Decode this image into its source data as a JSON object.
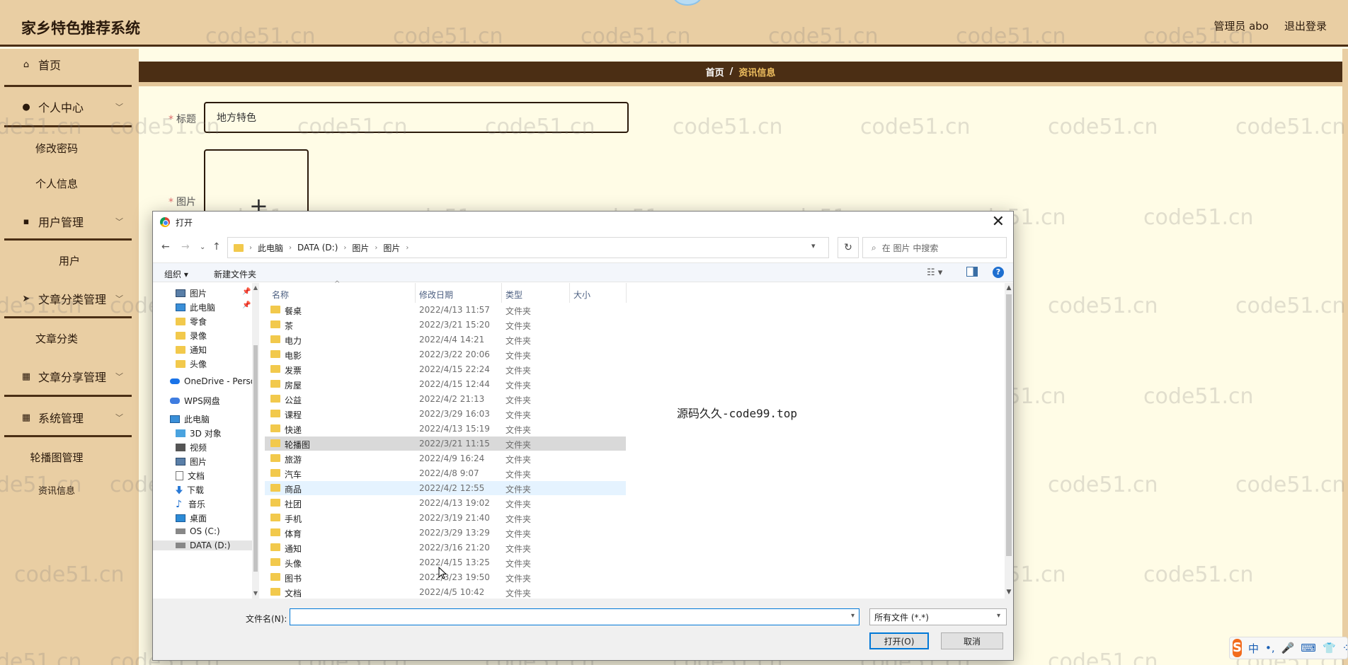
{
  "app": {
    "title": "家乡特色推荐系统",
    "user_label": "管理员 abo",
    "logout_label": "退出登录"
  },
  "sidebar": {
    "items": [
      {
        "label": "首页",
        "icon": "home-icon"
      },
      {
        "label": "个人中心",
        "icon": "user-icon"
      },
      {
        "label": "修改密码"
      },
      {
        "label": "个人信息"
      },
      {
        "label": "用户管理",
        "icon": "users-manage-icon"
      },
      {
        "label": "用户"
      },
      {
        "label": "文章分类管理",
        "icon": "send-icon"
      },
      {
        "label": "文章分类"
      },
      {
        "label": "文章分享管理",
        "icon": "grid-icon"
      },
      {
        "label": "系统管理",
        "icon": "grid-icon"
      },
      {
        "label": "轮播图管理"
      },
      {
        "label": "资讯信息"
      }
    ]
  },
  "breadcrumb": {
    "home": "首页",
    "separator": "/",
    "current": "资讯信息"
  },
  "form": {
    "title_label": "标题",
    "title_value": "地方特色",
    "image_label": "图片",
    "required_mark": "*",
    "upload_plus": "+"
  },
  "watermark": "code51.cn",
  "dialog": {
    "title": "打开",
    "close": "✕",
    "address": {
      "segments": [
        "此电脑",
        "DATA (D:)",
        "图片",
        "图片"
      ]
    },
    "search_placeholder": "在 图片 中搜索",
    "toolbar": {
      "organize": "组织 ▾",
      "new_folder": "新建文件夹"
    },
    "nav_pane": [
      {
        "label": "图片",
        "icon": "pictures-icon",
        "pinned": true
      },
      {
        "label": "此电脑",
        "icon": "pc-icon",
        "pinned": true
      },
      {
        "label": "零食",
        "icon": "folder-icon"
      },
      {
        "label": "录像",
        "icon": "folder-icon"
      },
      {
        "label": "通知",
        "icon": "folder-icon"
      },
      {
        "label": "头像",
        "icon": "folder-icon"
      },
      {
        "label": "OneDrive - Perso",
        "icon": "onedrive-icon"
      },
      {
        "label": "WPS网盘",
        "icon": "wps-cloud-icon"
      },
      {
        "label": "此电脑",
        "icon": "pc-icon"
      },
      {
        "label": "3D 对象",
        "icon": "3d-objects-icon"
      },
      {
        "label": "视频",
        "icon": "video-icon"
      },
      {
        "label": "图片",
        "icon": "pictures-icon"
      },
      {
        "label": "文档",
        "icon": "documents-icon"
      },
      {
        "label": "下载",
        "icon": "download-icon"
      },
      {
        "label": "音乐",
        "icon": "music-icon"
      },
      {
        "label": "桌面",
        "icon": "desktop-icon"
      },
      {
        "label": "OS (C:)",
        "icon": "drive-icon"
      },
      {
        "label": "DATA (D:)",
        "icon": "drive-icon"
      }
    ],
    "columns": [
      "名称",
      "修改日期",
      "类型",
      "大小"
    ],
    "files": [
      {
        "name": "餐桌",
        "date": "2022/4/13 11:57",
        "type": "文件夹"
      },
      {
        "name": "茶",
        "date": "2022/3/21 15:20",
        "type": "文件夹"
      },
      {
        "name": "电力",
        "date": "2022/4/4 14:21",
        "type": "文件夹"
      },
      {
        "name": "电影",
        "date": "2022/3/22 20:06",
        "type": "文件夹"
      },
      {
        "name": "发票",
        "date": "2022/4/15 22:24",
        "type": "文件夹"
      },
      {
        "name": "房屋",
        "date": "2022/4/15 12:44",
        "type": "文件夹"
      },
      {
        "name": "公益",
        "date": "2022/4/2 21:13",
        "type": "文件夹"
      },
      {
        "name": "课程",
        "date": "2022/3/29 16:03",
        "type": "文件夹"
      },
      {
        "name": "快递",
        "date": "2022/4/13 15:19",
        "type": "文件夹"
      },
      {
        "name": "轮播图",
        "date": "2022/3/21 11:15",
        "type": "文件夹"
      },
      {
        "name": "旅游",
        "date": "2022/4/9 16:24",
        "type": "文件夹"
      },
      {
        "name": "汽车",
        "date": "2022/4/8 9:07",
        "type": "文件夹"
      },
      {
        "name": "商品",
        "date": "2022/4/2 12:55",
        "type": "文件夹"
      },
      {
        "name": "社团",
        "date": "2022/4/13 19:02",
        "type": "文件夹"
      },
      {
        "name": "手机",
        "date": "2022/3/19 21:40",
        "type": "文件夹"
      },
      {
        "name": "体育",
        "date": "2022/3/29 13:29",
        "type": "文件夹"
      },
      {
        "name": "通知",
        "date": "2022/3/16 21:20",
        "type": "文件夹"
      },
      {
        "name": "头像",
        "date": "2022/4/15 13:25",
        "type": "文件夹"
      },
      {
        "name": "图书",
        "date": "2022/3/23 19:50",
        "type": "文件夹"
      },
      {
        "name": "文档",
        "date": "2022/4/5 10:42",
        "type": "文件夹"
      }
    ],
    "selected_file": "轮播图",
    "hovered_file": "商品",
    "overlay_text": "源码久久-code99.top",
    "filename_label": "文件名(N):",
    "filename_value": "",
    "filetype_value": "所有文件 (*.*)",
    "open_button": "打开(O)",
    "cancel_button": "取消"
  },
  "ime": {
    "logo": "S",
    "items": [
      "中",
      "•,",
      "🎤",
      "⌨",
      "👕",
      "⁘"
    ]
  },
  "colors": {
    "header_bg": "#e9cea3",
    "header_line": "#4a2e14",
    "page_bg": "#fffce6",
    "crumb_bg": "#4b2e14",
    "crumb_active": "#f0c060",
    "selected_row": "#d9d9d9",
    "accent_blue": "#0078d7"
  }
}
